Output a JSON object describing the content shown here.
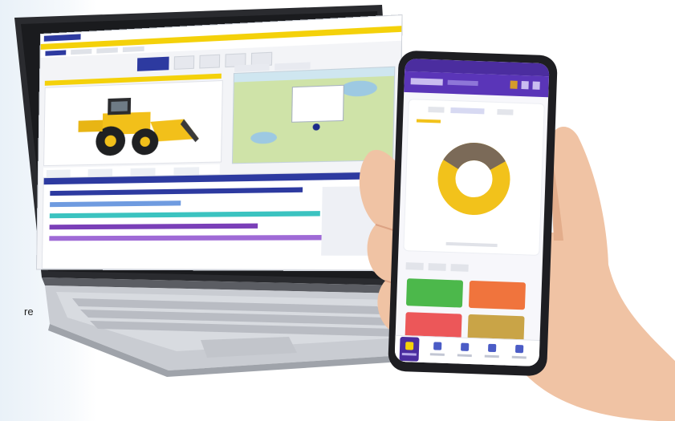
{
  "side_text": "re",
  "laptop": {
    "screen_label": "fleet-monitoring-dashboard",
    "colors": {
      "brand": "#2d3aa0",
      "accent": "#f4d10a",
      "teal": "#3bc3c0",
      "purple": "#7a3fb8"
    },
    "icons": [
      "loader-machine-icon",
      "map-pin-icon"
    ]
  },
  "phone": {
    "colors": {
      "header": "#5a35b8",
      "donut_primary": "#f2c21b",
      "donut_secondary": "#7b6a58"
    },
    "tiles": [
      {
        "name": "green-tile",
        "color": "#4cb84b"
      },
      {
        "name": "orange-tile",
        "color": "#f0743d"
      },
      {
        "name": "red-tile",
        "color": "#ec5759"
      },
      {
        "name": "olive-tile",
        "color": "#c9a447"
      }
    ],
    "donut": {
      "primary_fraction": 0.67,
      "secondary_fraction": 0.33
    }
  }
}
